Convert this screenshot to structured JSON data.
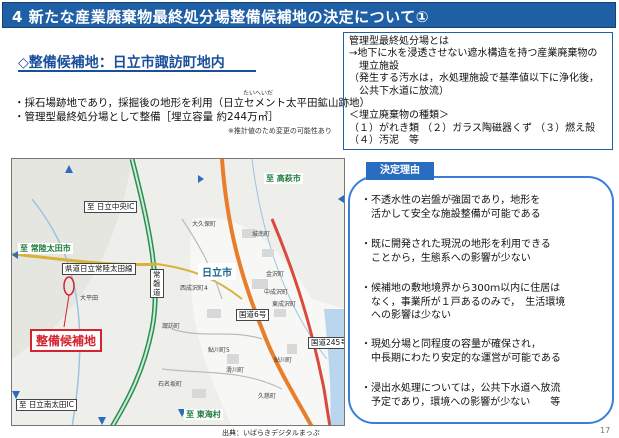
{
  "header": {
    "title": "4 新たな産業廃棄物最終処分場整備候補地の決定について①"
  },
  "site": {
    "title": "◇整備候補地：日立市諏訪町地内",
    "bullets": [
      "・採石場跡地であり，採掘後の地形を利用（日立セメント太平田鉱山跡地）",
      "・管理型最終処分場として整備［埋立容量 約244万㎥］"
    ],
    "ruby": "たいへいだ",
    "note": "※推計値のため変更の可能性あり"
  },
  "definition": {
    "lines": [
      "管理型最終処分場とは",
      "→地下に水を浸透させない遮水構造を持つ産業廃棄物の",
      "　埋立施設",
      "（発生する汚水は，水処理施設で基準値以下に浄化後，",
      "　公共下水道に放流）",
      "",
      "＜埋立廃棄物の種類＞",
      "（１）がれき類 （２）ガラス陶磁器くず （３）燃え殻",
      "（４）汚泥　等"
    ]
  },
  "map": {
    "labels": {
      "to_takahagi": "至 高萩市",
      "to_hitachi_chuo_ic": "至 日立中央IC",
      "to_hitachiota": "至 常陸太田市",
      "ken_road": "県道日立常陸太田線",
      "joban": "常磐道",
      "hitachi_city": "日立市",
      "site": "整備候補地",
      "route6": "国道6号",
      "route245": "国道245号",
      "to_hitachi_minami_ic": "至 日立南太田IC",
      "to_tokai": "至 東海村",
      "osawa": "西成沢町4",
      "suwa": "諏訪町",
      "kanezawa": "金沢町",
      "nakanarusawa": "中成沢町",
      "ayukawa": "鮎川町",
      "shirogane": "城南町",
      "jonan": "滑川町",
      "higashinaka": "東成沢町",
      "kujicho": "久慈町",
      "ishinazaka": "石名坂町",
      "shinshukei": "国道6号",
      "komyojicho": "鮎川町5",
      "okubo": "大久保町",
      "taiheida": "大平田"
    },
    "source": "出典：いばらきデジタルまっぷ"
  },
  "reasons": {
    "heading": "決定理由",
    "items": [
      [
        "・不透水性の岩盤が強固であり，地形を",
        "　活かして安全な施設整備が可能である"
      ],
      [
        "・既に開発された現況の地形を利用できる",
        "　ことから，生態系への影響が少ない"
      ],
      [
        "・候補地の敷地境界から300ｍ以内に住居は",
        "　なく，事業所が１戸あるのみで，　生活環境",
        "　への影響は少ない"
      ],
      [
        "・現処分場と同程度の容量が確保され，",
        "　中長期にわたり安定的な運営が可能である"
      ],
      [
        "・浸出水処理については，公共下水道へ放流",
        "　予定であり，環境への影響が少ない　　等"
      ]
    ]
  },
  "footer": {
    "page": "17"
  },
  "colors": {
    "title_bg": "#1f5fa5",
    "accent_blue": "#2a6cc0",
    "site_red": "#d4232e",
    "road_green": "#1d7a3a"
  }
}
